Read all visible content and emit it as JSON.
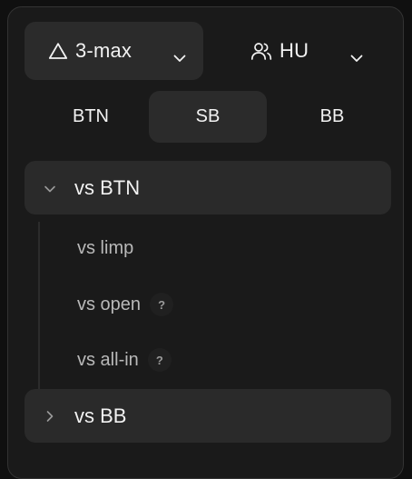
{
  "format_select": {
    "icon": "triangle-icon",
    "label": "3-max"
  },
  "mode_select": {
    "icon": "users-icon",
    "label": "HU"
  },
  "positions": [
    {
      "label": "BTN",
      "active": false
    },
    {
      "label": "SB",
      "active": true
    },
    {
      "label": "BB",
      "active": false
    }
  ],
  "groups": [
    {
      "label": "vs BTN",
      "expanded": true,
      "items": [
        {
          "label": "vs limp",
          "help": ""
        },
        {
          "label": "vs open",
          "help": "?"
        },
        {
          "label": "vs all-in",
          "help": "?"
        }
      ]
    },
    {
      "label": "vs BB",
      "expanded": false
    }
  ]
}
